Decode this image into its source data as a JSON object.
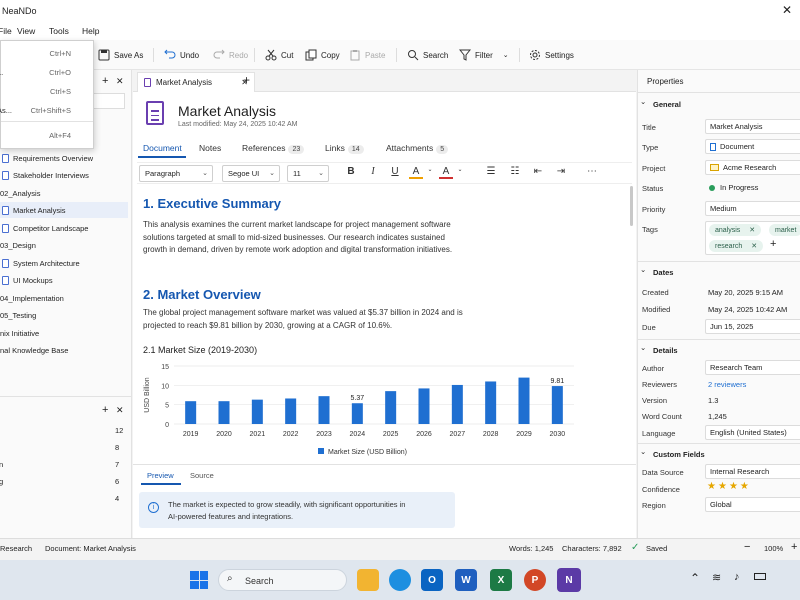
{
  "window": {
    "title": "NeaNDo"
  },
  "menu": [
    "File",
    "View",
    "Tools",
    "Help"
  ],
  "file_menu": [
    {
      "label": "",
      "shortcut": "Ctrl+N"
    },
    {
      "label": "...",
      "shortcut": "Ctrl+O"
    },
    {
      "label": "",
      "shortcut": "Ctrl+S"
    },
    {
      "label": "As...",
      "shortcut": "Ctrl+Shift+S"
    },
    {
      "label": "",
      "shortcut": "Alt+F4"
    }
  ],
  "toolbar": {
    "save_as": "Save As",
    "undo": "Undo",
    "redo": "Redo",
    "cut": "Cut",
    "copy": "Copy",
    "paste": "Paste",
    "search": "Search",
    "filter": "Filter",
    "settings": "Settings"
  },
  "tree": [
    {
      "label": "Requirements Overview",
      "doc": true
    },
    {
      "label": "Stakeholder Interviews",
      "doc": true
    },
    {
      "label": "02_Analysis",
      "doc": false
    },
    {
      "label": "Market Analysis",
      "doc": true,
      "selected": true
    },
    {
      "label": "Competitor Landscape",
      "doc": true
    },
    {
      "label": "03_Design",
      "doc": false
    },
    {
      "label": "System Architecture",
      "doc": true
    },
    {
      "label": "UI Mockups",
      "doc": true
    },
    {
      "label": "04_Implementation",
      "doc": false
    },
    {
      "label": "05_Testing",
      "doc": false
    },
    {
      "label": "nix Initiative",
      "doc": false
    },
    {
      "label": "nal Knowledge Base",
      "doc": false
    }
  ],
  "tags_panel": [
    {
      "label": "",
      "count": "12"
    },
    {
      "label": "",
      "count": "8"
    },
    {
      "label": "n",
      "count": "7"
    },
    {
      "label": "g",
      "count": "6"
    },
    {
      "label": "",
      "count": "4"
    }
  ],
  "doc_tab": "Market Analysis",
  "doc": {
    "title": "Market Analysis",
    "modified": "Last modified: May 24, 2025 10:42 AM",
    "tabs": {
      "document": "Document",
      "notes": "Notes",
      "references": "References",
      "references_count": "23",
      "links": "Links",
      "links_count": "14",
      "attachments": "Attachments",
      "attachments_count": "5"
    },
    "format": {
      "style": "Paragraph",
      "font": "Segoe UI",
      "size": "11"
    },
    "h1": "1. Executive Summary",
    "p1": "This analysis examines the current market landscape for project management software solutions targeted at small to mid-sized businesses. Our research indicates sustained growth in demand, driven by remote work adoption and digital transformation initiatives.",
    "h2": "2. Market Overview",
    "p2": "The global project management software market was valued at $5.37 billion in 2024 and is projected to reach $9.81 billion by 2030, growing at a CAGR of 10.6%.",
    "h3": "2.1  Market Size (2019-2030)"
  },
  "chart_data": {
    "type": "bar",
    "categories": [
      "2019",
      "2020",
      "2021",
      "2022",
      "2023",
      "2024",
      "2025",
      "2026",
      "2027",
      "2028",
      "2029",
      "2030"
    ],
    "values": [
      5.9,
      5.9,
      6.3,
      6.6,
      7.2,
      5.37,
      8.5,
      9.2,
      10.1,
      11.0,
      12.0,
      9.81
    ],
    "series": [
      {
        "name": "Market Size (USD Billion)"
      }
    ],
    "data_labels": {
      "5": "5.37",
      "11": "9.81"
    },
    "ylabel": "USD Billion",
    "yticks": [
      0,
      5,
      10,
      15
    ],
    "ylim": [
      0,
      15
    ],
    "grid": true,
    "legend_placement": "bottom",
    "color": "#1f6fd1"
  },
  "preview": {
    "tab_preview": "Preview",
    "tab_source": "Source",
    "note": "The market is expected to grow steadily, with significant opportunities in AI-powered features and integrations."
  },
  "properties": {
    "header": "Properties",
    "general": "General",
    "title_label": "Title",
    "title_value": "Market Analysis",
    "type_label": "Type",
    "type_value": "Document",
    "project_label": "Project",
    "project_value": "Acme Research",
    "status_label": "Status",
    "status_value": "In Progress",
    "priority_label": "Priority",
    "priority_value": "Medium",
    "tags_label": "Tags",
    "tags": [
      "analysis",
      "market",
      "research"
    ],
    "dates": "Dates",
    "created_label": "Created",
    "created_value": "May 20, 2025 9:15 AM",
    "modified_label": "Modified",
    "modified_value": "May 24, 2025 10:42 AM",
    "due_label": "Due",
    "due_value": "Jun 15, 2025",
    "details": "Details",
    "author_label": "Author",
    "author_value": "Research Team",
    "reviewers_label": "Reviewers",
    "reviewers_value": "2 reviewers",
    "version_label": "Version",
    "version_value": "1.3",
    "wordcount_label": "Word Count",
    "wordcount_value": "1,245",
    "language_label": "Language",
    "language_value": "English (United States)",
    "custom": "Custom Fields",
    "datasource_label": "Data Source",
    "datasource_value": "Internal Research",
    "confidence_label": "Confidence",
    "confidence_stars": 4,
    "region_label": "Region",
    "region_value": "Global"
  },
  "status": {
    "left1": "Research",
    "left2": "Document: Market Analysis",
    "words": "Words: 1,245",
    "chars": "Characters: 7,892",
    "saved": "Saved",
    "zoom": "100%"
  },
  "taskbar": {
    "search": "Search"
  }
}
